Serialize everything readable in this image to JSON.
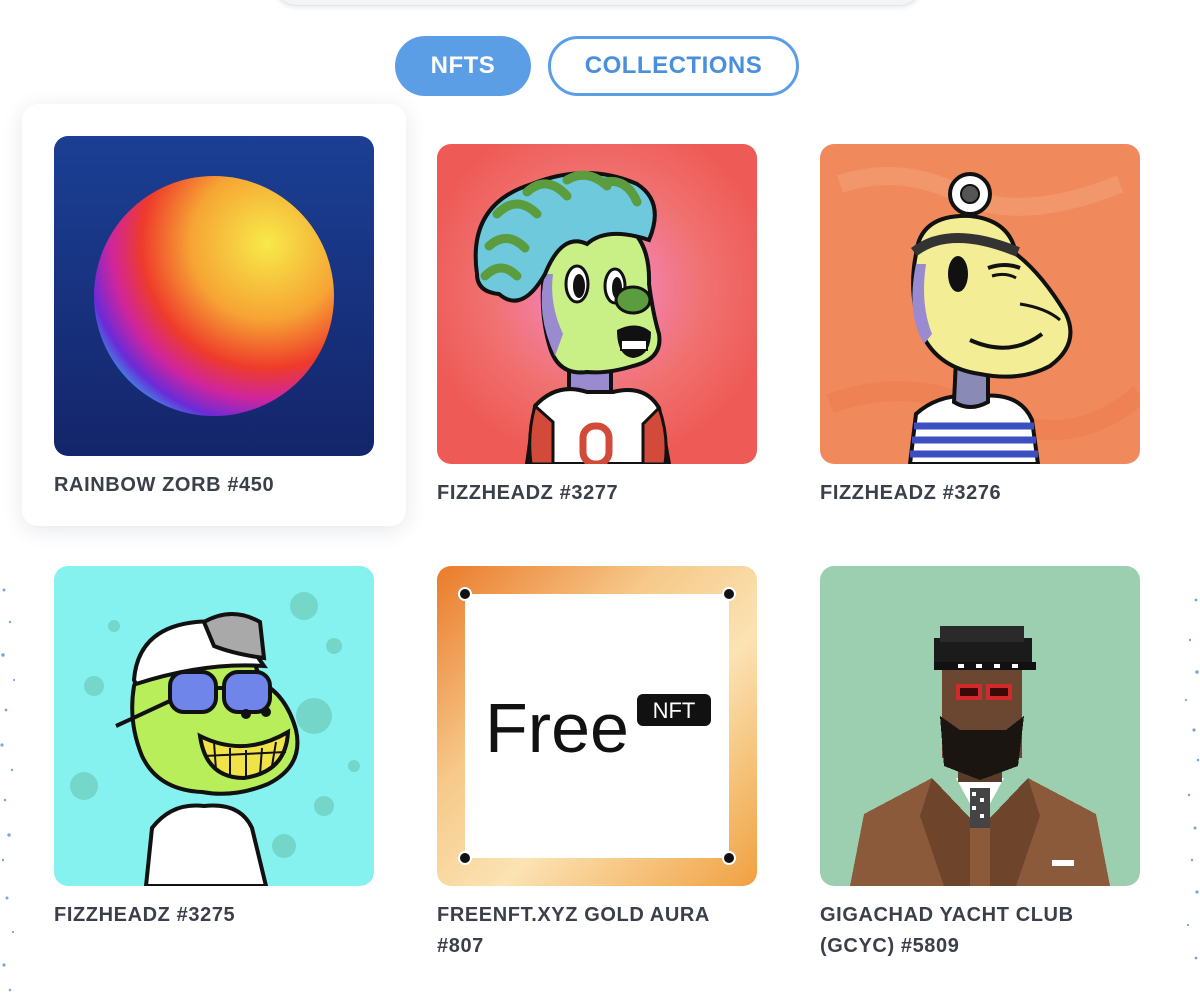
{
  "tabs": {
    "nfts_label": "NFTS",
    "collections_label": "COLLECTIONS",
    "active": "NFTS"
  },
  "colors": {
    "accent": "#5b9ee6",
    "title_text": "#3a3f4a"
  },
  "nfts": [
    {
      "title": "RAINBOW ZORB #450",
      "art": "rainbow-zorb-sphere"
    },
    {
      "title": "FIZZHEADZ #3277",
      "art": "fizzheadz-striped-hair"
    },
    {
      "title": "FIZZHEADZ #3276",
      "art": "fizzheadz-headlamp"
    },
    {
      "title": "FIZZHEADZ #3275",
      "art": "fizzheadz-sunglasses-cap"
    },
    {
      "title": "FREENFT.XYZ GOLD AURA #807",
      "art": "freenft-gold-aura",
      "art_text": "Free",
      "badge_text": "NFT"
    },
    {
      "title": "GIGACHAD YACHT CLUB (GCYC) #5809",
      "art": "gigachad-captain"
    }
  ]
}
